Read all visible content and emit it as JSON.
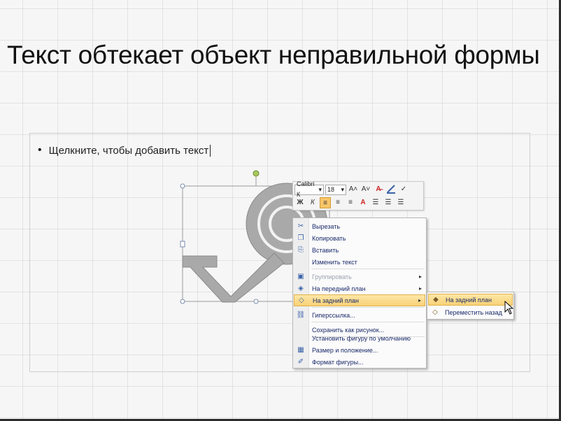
{
  "slide": {
    "title": "Текст обтекает объект неправильной формы",
    "bullet_text": "Щелкните, чтобы добавить текст"
  },
  "mini_toolbar": {
    "font_name": "Calibri К",
    "font_size": "18",
    "row1_buttons": [
      "A˄",
      "A˅",
      "A̶",
      "✓"
    ],
    "row2_buttons": [
      "Ж",
      "К",
      "≡",
      "≡",
      "≡",
      "A",
      "☰",
      "☰",
      "☰"
    ]
  },
  "context_menu": {
    "items": [
      {
        "label": "Вырезать",
        "icon": "scissors-icon",
        "glyph": "✂",
        "disabled": false,
        "arrow": false
      },
      {
        "label": "Копировать",
        "icon": "copy-icon",
        "glyph": "❐",
        "disabled": false,
        "arrow": false
      },
      {
        "label": "Вставить",
        "icon": "paste-icon",
        "glyph": "⎘",
        "disabled": false,
        "arrow": false
      },
      {
        "label": "Изменить текст",
        "icon": "edit-text-icon",
        "glyph": "",
        "disabled": false,
        "arrow": false
      },
      {
        "label": "Группировать",
        "icon": "group-icon",
        "glyph": "▣",
        "disabled": true,
        "arrow": true
      },
      {
        "label": "На передний план",
        "icon": "bring-front-icon",
        "glyph": "◈",
        "disabled": false,
        "arrow": true
      },
      {
        "label": "На задний план",
        "icon": "send-back-icon",
        "glyph": "◇",
        "disabled": false,
        "arrow": true
      },
      {
        "label": "Гиперссылка...",
        "icon": "hyperlink-icon",
        "glyph": "⛓",
        "disabled": false,
        "arrow": false
      },
      {
        "label": "Сохранить как рисунок...",
        "icon": "save-picture-icon",
        "glyph": "",
        "disabled": false,
        "arrow": false
      },
      {
        "label": "Установить фигуру по умолчанию",
        "icon": "default-shape-icon",
        "glyph": "",
        "disabled": false,
        "arrow": false
      },
      {
        "label": "Размер и положение...",
        "icon": "size-position-icon",
        "glyph": "▦",
        "disabled": false,
        "arrow": false
      },
      {
        "label": "Формат фигуры...",
        "icon": "format-shape-icon",
        "glyph": "✐",
        "disabled": false,
        "arrow": false
      }
    ]
  },
  "submenu": {
    "items": [
      {
        "label": "На задний план",
        "icon": "send-to-back-icon",
        "glyph": "◆"
      },
      {
        "label": "Переместить назад",
        "icon": "send-backward-icon",
        "glyph": "◇"
      }
    ]
  },
  "colors": {
    "menu_highlight": "#f8d277",
    "menu_text": "#1a2a6a",
    "shape_fill": "#a9a9a9",
    "handle_green": "#a6c85a"
  }
}
